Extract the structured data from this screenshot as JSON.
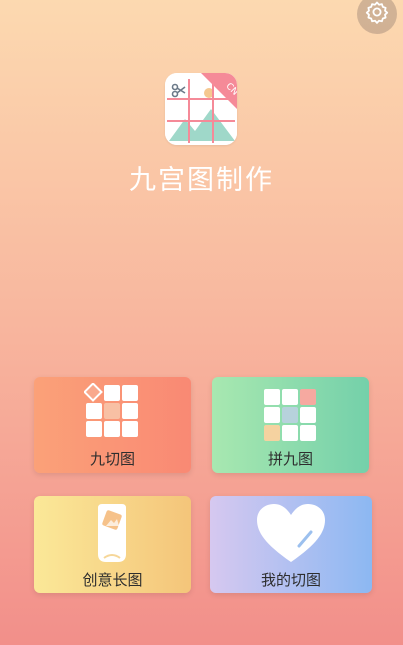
{
  "app": {
    "title": "九宫图制作",
    "logo_badge": "CN"
  },
  "icons": {
    "settings": "gear-icon",
    "logo": "app-logo-icon"
  },
  "cards": [
    {
      "id": "nine-cut",
      "label": "九切图",
      "icon": "nine-grid-icon",
      "color_start": "#fba178",
      "color_end": "#f98974"
    },
    {
      "id": "join-nine",
      "label": "拼九图",
      "icon": "join-grid-icon",
      "color_start": "#a8e8b0",
      "color_end": "#74d0aa"
    },
    {
      "id": "long-image",
      "label": "创意长图",
      "icon": "scroll-image-icon",
      "color_start": "#fbe898",
      "color_end": "#f4c57a"
    },
    {
      "id": "my-cuts",
      "label": "我的切图",
      "icon": "heart-icon",
      "color_start": "#d6c8f0",
      "color_end": "#8cb8f2"
    }
  ]
}
